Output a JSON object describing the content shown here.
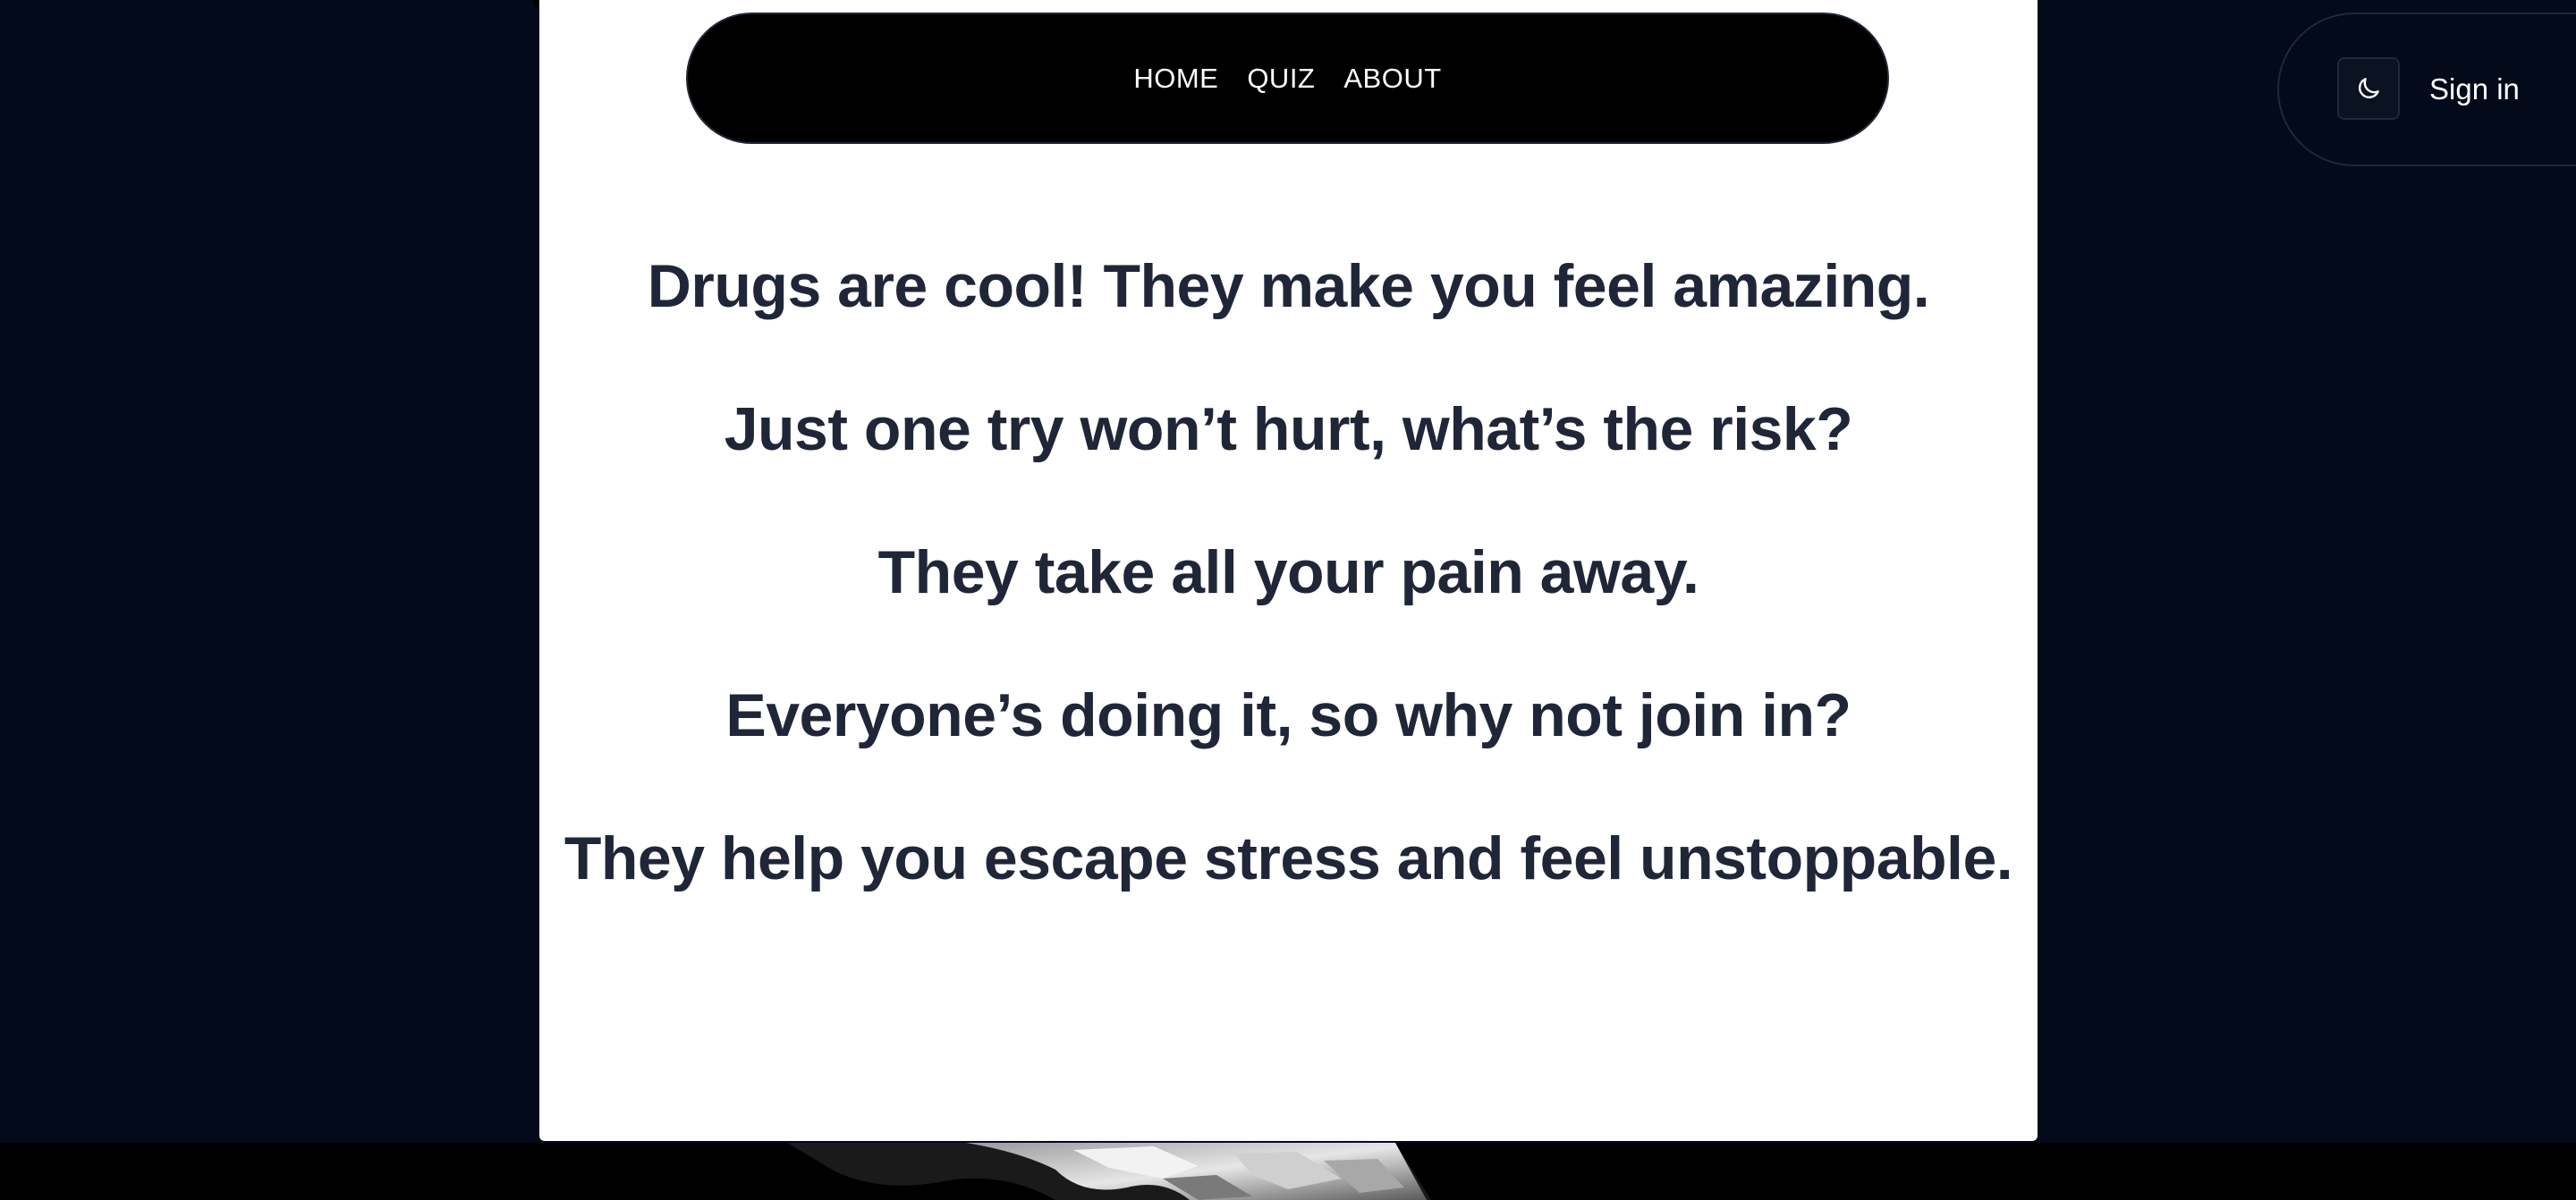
{
  "nav": {
    "items": [
      {
        "label": "HOME"
      },
      {
        "label": "QUIZ"
      },
      {
        "label": "ABOUT"
      }
    ]
  },
  "main": {
    "headlines": [
      "Drugs are cool! They make you feel amazing.",
      "Just one try won’t hurt, what’s the risk?",
      "They take all your pain away.",
      "Everyone’s doing it, so why not join in?",
      "They help you escape stress and feel unstoppable."
    ]
  },
  "auth": {
    "theme_toggle_icon": "moon-icon",
    "sign_in_label": "Sign in"
  },
  "colors": {
    "page_background": "#030a1a",
    "card_background": "#ffffff",
    "navbar_background": "#000000",
    "headline_text": "#1f2638",
    "nav_text": "#ffffff"
  }
}
